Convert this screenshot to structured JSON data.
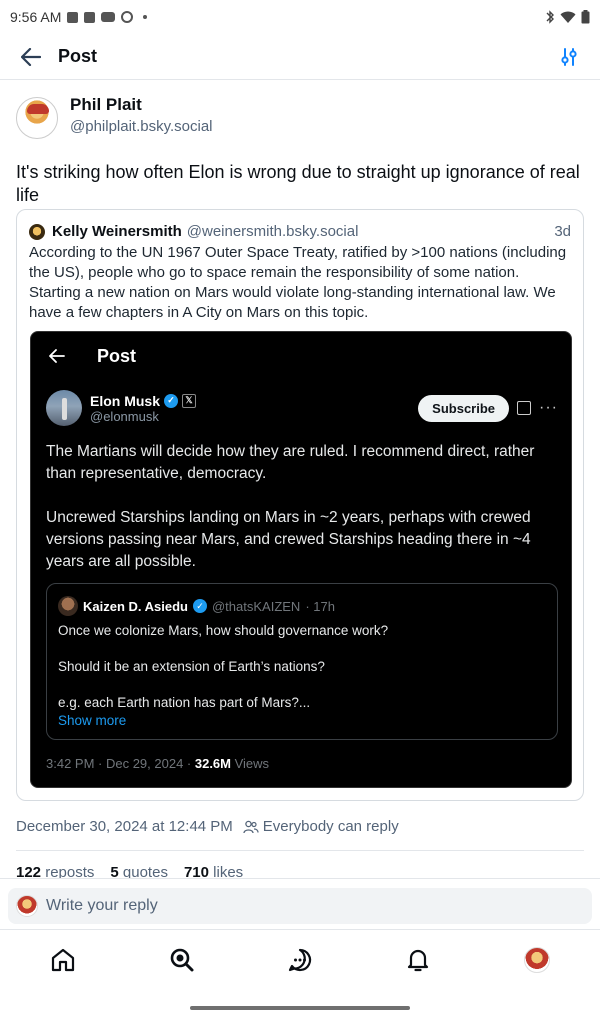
{
  "status_bar": {
    "time": "9:56 AM"
  },
  "header": {
    "title": "Post"
  },
  "post": {
    "author_name": "Phil Plait",
    "author_handle": "@philplait.bsky.social",
    "text": "It's striking how often Elon is wrong due to straight up ignorance of real life"
  },
  "quote": {
    "author_name": "Kelly Weinersmith",
    "author_handle": "@weinersmith.bsky.social",
    "time": "3d",
    "text": "According to the UN 1967 Outer Space Treaty, ratified by >100 nations (including the US), people who go to space remain the responsibility of some nation. Starting a new nation on Mars would violate long-standing international law. We have a few chapters in A City on Mars on this topic.",
    "embed": {
      "title": "Post",
      "author_name": "Elon Musk",
      "author_handle": "@elonmusk",
      "subscribe_label": "Subscribe",
      "paragraph1": "The Martians will decide how they are ruled. I recommend direct, rather than representative, democracy.",
      "paragraph2": "Uncrewed Starships landing on Mars in ~2 years, perhaps with crewed versions passing near Mars, and crewed Starships heading there in ~4 years are all possible.",
      "inner": {
        "author_name": "Kaizen D. Asiedu",
        "author_handle": "@thatsKAIZEN",
        "time": "· 17h",
        "line1": "Once we colonize Mars, how should governance work?",
        "line2": "Should it be an extension of Earth’s nations?",
        "line3": "e.g. each Earth nation has part of Mars?...",
        "show_more": "Show more"
      },
      "meta_time": "3:42 PM · Dec 29, 2024 · ",
      "views_count": "32.6M",
      "views_label": " Views"
    }
  },
  "meta": {
    "timestamp": "December 30, 2024 at 12:44 PM",
    "reply_setting": "Everybody can reply"
  },
  "stats": {
    "reposts_count": "122",
    "reposts_label": " reposts",
    "quotes_count": "5",
    "quotes_label": " quotes",
    "likes_count": "710",
    "likes_label": " likes"
  },
  "reply": {
    "placeholder": "Write your reply"
  },
  "nav": {
    "items": [
      "home-icon",
      "search-icon",
      "chat-icon",
      "bell-icon",
      "profile-avatar"
    ]
  },
  "colors": {
    "accent": "#1083fe",
    "muted": "#546478",
    "embed_bg": "#000000",
    "verified": "#1d9bf0"
  }
}
